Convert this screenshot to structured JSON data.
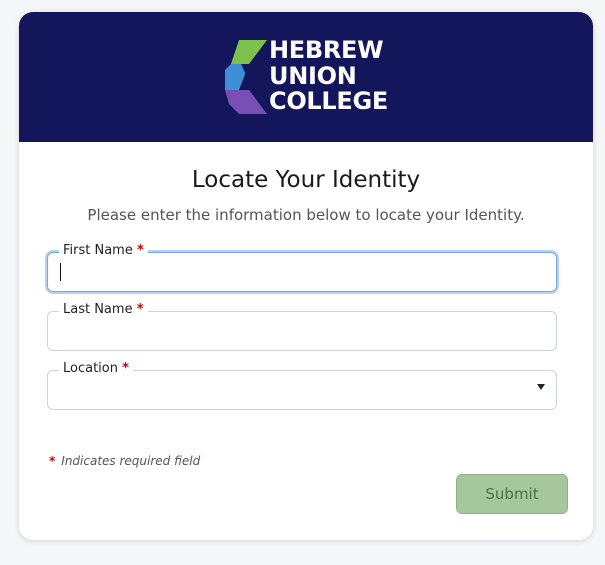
{
  "brand": {
    "logo_lines": [
      "HEBREW",
      "UNION",
      "COLLEGE"
    ],
    "header_color": "#13165a",
    "mark_colors": [
      "#7ec14a",
      "#3f8fd6",
      "#7a4fb5"
    ]
  },
  "page": {
    "title": "Locate Your Identity",
    "subtitle": "Please enter the information below to locate your Identity."
  },
  "form": {
    "first_name": {
      "label": "First Name",
      "required_marker": "*",
      "value": ""
    },
    "last_name": {
      "label": "Last Name",
      "required_marker": "*",
      "value": ""
    },
    "location": {
      "label": "Location",
      "required_marker": "*",
      "selected": ""
    },
    "required_note": {
      "marker": "*",
      "text": "Indicates required field"
    },
    "submit_label": "Submit",
    "submit_color": "#a6c79c"
  }
}
